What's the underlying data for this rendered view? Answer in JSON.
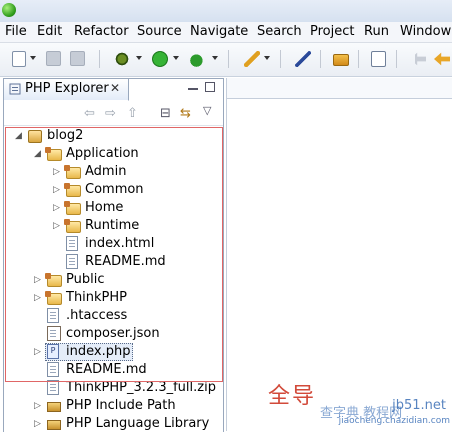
{
  "menubar": {
    "items": [
      "File",
      "Edit",
      "Refactor",
      "Source",
      "Navigate",
      "Search",
      "Project",
      "Run",
      "Window"
    ]
  },
  "toolbar": {
    "icons": [
      "new-wizard-icon",
      "save-icon",
      "save-all-icon",
      "debug-icon",
      "run-icon",
      "external-tools-icon",
      "open-type-icon",
      "open-task-icon",
      "open-resource-icon",
      "new-php-project-icon",
      "back-icon",
      "forward-icon"
    ]
  },
  "explorer": {
    "tab_title": "PHP Explorer",
    "tab_close": "✕",
    "tree": [
      {
        "label": "blog2",
        "depth": 0,
        "type": "project",
        "state": "expanded"
      },
      {
        "label": "Application",
        "depth": 1,
        "type": "package-folder",
        "state": "expanded"
      },
      {
        "label": "Admin",
        "depth": 2,
        "type": "package-folder",
        "state": "collapsed"
      },
      {
        "label": "Common",
        "depth": 2,
        "type": "package-folder",
        "state": "collapsed"
      },
      {
        "label": "Home",
        "depth": 2,
        "type": "package-folder",
        "state": "collapsed"
      },
      {
        "label": "Runtime",
        "depth": 2,
        "type": "package-folder",
        "state": "collapsed"
      },
      {
        "label": "index.html",
        "depth": 2,
        "type": "file",
        "state": "leaf"
      },
      {
        "label": "README.md",
        "depth": 2,
        "type": "file",
        "state": "leaf"
      },
      {
        "label": "Public",
        "depth": 1,
        "type": "package-folder",
        "state": "collapsed"
      },
      {
        "label": "ThinkPHP",
        "depth": 1,
        "type": "package-folder",
        "state": "collapsed"
      },
      {
        "label": ".htaccess",
        "depth": 1,
        "type": "file",
        "state": "leaf"
      },
      {
        "label": "composer.json",
        "depth": 1,
        "type": "json-file",
        "state": "leaf"
      },
      {
        "label": "index.php",
        "depth": 1,
        "type": "php-file",
        "state": "collapsed",
        "selected": true
      },
      {
        "label": "README.md",
        "depth": 1,
        "type": "file",
        "state": "leaf"
      },
      {
        "label": "ThinkPHP_3.2.3_full.zip",
        "depth": 1,
        "type": "file",
        "state": "leaf"
      },
      {
        "label": "PHP Include Path",
        "depth": 1,
        "type": "library",
        "state": "collapsed"
      },
      {
        "label": "PHP Language Library",
        "depth": 1,
        "type": "library",
        "state": "collapsed"
      }
    ]
  },
  "overlay_text": "全导",
  "watermark": {
    "main": "jb51.net",
    "sub": "jiaocheng.chazidian.com",
    "cn": "查字典 教程网"
  },
  "colors": {
    "highlight_box": "#e06666",
    "overlay_text": "#d24a3a",
    "selection": "#e5edf9"
  }
}
